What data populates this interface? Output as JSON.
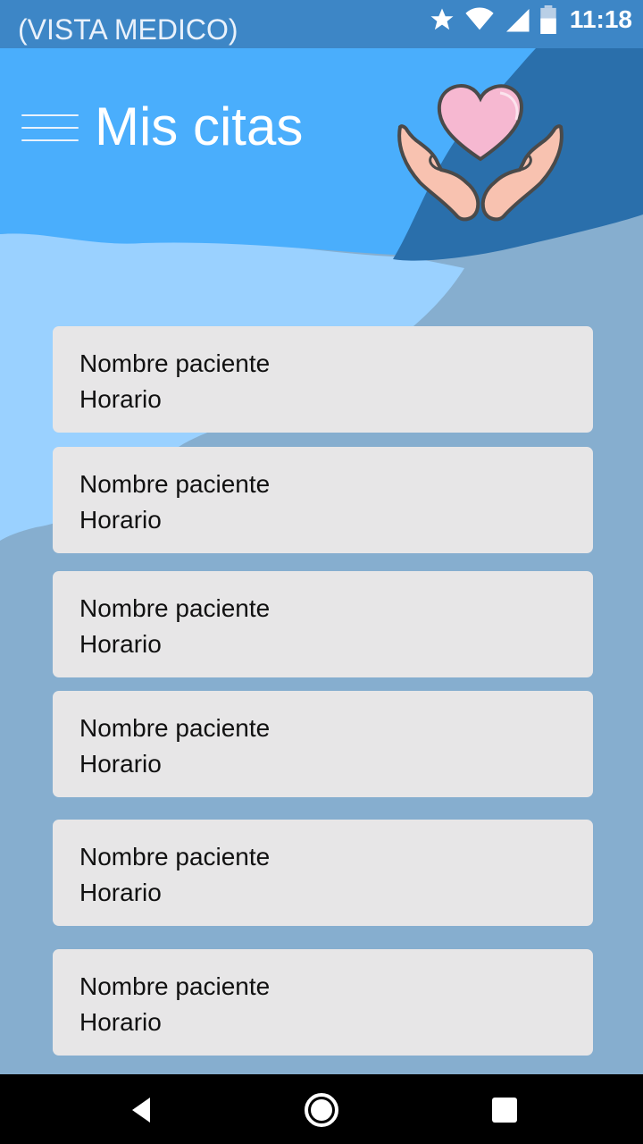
{
  "status_bar": {
    "label": "(VISTA MEDICO)",
    "time": "11:18",
    "icons": [
      "star-icon",
      "wifi-icon",
      "signal-icon",
      "battery-icon"
    ]
  },
  "header": {
    "title": "Mis citas",
    "menu_icon": "hamburger-menu-icon",
    "logo": "heart-in-hands-logo"
  },
  "appointments": [
    {
      "name": "Nombre paciente",
      "time": "Horario"
    },
    {
      "name": "Nombre paciente",
      "time": "Horario"
    },
    {
      "name": "Nombre paciente",
      "time": "Horario"
    },
    {
      "name": "Nombre paciente",
      "time": "Horario"
    },
    {
      "name": "Nombre paciente",
      "time": "Horario"
    },
    {
      "name": "Nombre paciente",
      "time": "Horario"
    }
  ],
  "nav_bar": {
    "buttons": [
      "back-icon",
      "home-icon",
      "recents-icon"
    ]
  },
  "colors": {
    "status_bar": "#3d86c6",
    "header_blue": "#4aaefc",
    "dark_blue": "#2a6fab",
    "light_wave": "#9ad1ff",
    "page_bg": "#86aecf",
    "card_bg": "#e7e6e7"
  }
}
